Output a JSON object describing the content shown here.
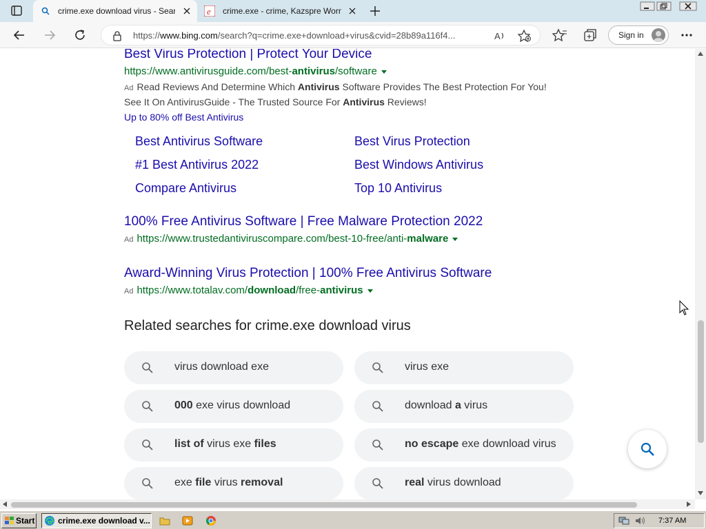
{
  "browser": {
    "tabs": [
      {
        "title": "crime.exe download virus - Search"
      },
      {
        "title": "crime.exe - crime, Kazspre Worm"
      }
    ],
    "address_url": "https://www.bing.com/search?q=crime.exe+download+virus&cvid=28b89a116f4...",
    "address_host_prefix": "https://",
    "address_host": "www.bing.com",
    "address_rest": "/search?q=crime.exe+download+virus&cvid=28b89a116f4...",
    "signin_label": "Sign in"
  },
  "ads": [
    {
      "title": "Best Virus Protection | Protect Your Device",
      "url_parts": [
        "https://www.antivirusguide.com/best-",
        "antivirus",
        "/software"
      ],
      "badge": "Ad",
      "desc1_parts": [
        "Read Reviews And Determine Which ",
        "Antivirus",
        " Software Provides The Best Protection For You!"
      ],
      "desc2_parts": [
        "See It On AntivirusGuide - The Trusted Source For ",
        "Antivirus",
        " Reviews!"
      ],
      "promo": "Up to 80% off Best Antivirus",
      "sitelinks": [
        "Best Antivirus Software",
        "Best Virus Protection",
        "#1 Best Antivirus 2022",
        "Best Windows Antivirus",
        "Compare Antivirus",
        "Top 10 Antivirus"
      ]
    },
    {
      "title": "100% Free Antivirus Software | Free Malware Protection 2022",
      "badge": "Ad",
      "url_parts": [
        "https://www.trustedantiviruscompare.com/best-10-free/anti-",
        "malware",
        ""
      ]
    },
    {
      "title": "Award-Winning Virus Protection | 100% Free Antivirus Software",
      "badge": "Ad",
      "url_parts": [
        "https://www.totalav.com/",
        "download",
        "/free-",
        "antivirus",
        ""
      ]
    }
  ],
  "related": {
    "heading": "Related searches for crime.exe download virus",
    "items": [
      {
        "parts": [
          [
            "",
            false
          ],
          [
            "virus download exe",
            false
          ]
        ]
      },
      {
        "parts": [
          [
            "",
            false
          ],
          [
            "virus exe",
            false
          ]
        ]
      },
      {
        "parts": [
          [
            "000",
            true
          ],
          [
            " exe virus download",
            false
          ]
        ]
      },
      {
        "parts": [
          [
            "download ",
            false
          ],
          [
            "a",
            true
          ],
          [
            " virus",
            false
          ]
        ]
      },
      {
        "parts": [
          [
            "list of",
            true
          ],
          [
            " virus exe ",
            false
          ],
          [
            "files",
            true
          ]
        ]
      },
      {
        "parts": [
          [
            "no escape",
            true
          ],
          [
            " exe download virus",
            false
          ]
        ]
      },
      {
        "parts": [
          [
            "exe ",
            false
          ],
          [
            "file",
            true
          ],
          [
            " virus ",
            false
          ],
          [
            "removal",
            true
          ]
        ]
      },
      {
        "parts": [
          [
            "real",
            true
          ],
          [
            " virus download",
            false
          ]
        ]
      }
    ]
  },
  "taskbar": {
    "start_label": "Start",
    "task_label": "crime.exe download v...",
    "clock": "7:37 AM"
  },
  "icons": {
    "search": "magnifier-icon",
    "refresh": "refresh-icon",
    "back": "back-arrow-icon",
    "forward": "forward-arrow-icon"
  }
}
